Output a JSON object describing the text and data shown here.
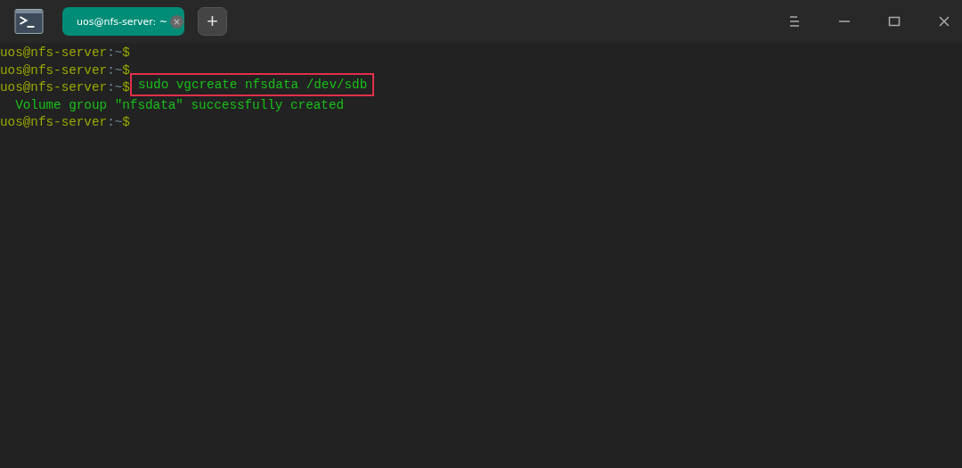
{
  "tabs": [
    {
      "label": "uos@nfs-server: ~",
      "selected": true,
      "close": "×"
    }
  ],
  "new_tab": "+",
  "terminal": {
    "lines": [
      {
        "kind": "prompt",
        "user_host": "uos@nfs-server",
        "path": ":~",
        "symbol": "$"
      },
      {
        "kind": "prompt",
        "user_host": "uos@nfs-server",
        "path": ":~",
        "symbol": "$"
      },
      {
        "kind": "prompt",
        "user_host": "uos@nfs-server",
        "path": ":~",
        "symbol": "$",
        "command": "sudo vgcreate nfsdata /dev/sdb",
        "highlighted": true
      },
      {
        "kind": "output",
        "text": "  Volume group \"nfsdata\" successfully created"
      },
      {
        "kind": "prompt",
        "user_host": "uos@nfs-server",
        "path": ":~",
        "symbol": "$"
      }
    ]
  }
}
